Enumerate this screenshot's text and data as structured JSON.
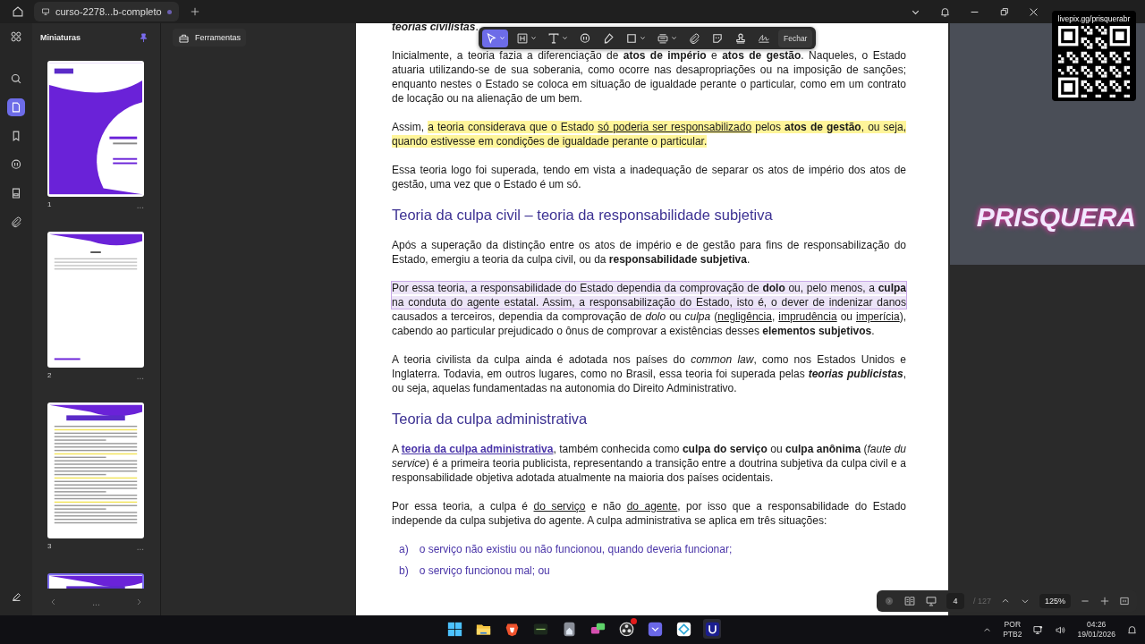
{
  "tab_bar": {
    "tab_title": "curso-2278...b-completo"
  },
  "rail": {
    "items": [
      {
        "selected": false
      },
      {
        "selected": true
      },
      {
        "selected": false
      },
      {
        "selected": false
      },
      {
        "selected": false
      },
      {
        "selected": false
      }
    ]
  },
  "thumbnails": {
    "title": "Miniaturas",
    "pages": [
      {
        "kind": "cover",
        "number": "1",
        "selected": false
      },
      {
        "kind": "index",
        "number": "2",
        "selected": false
      },
      {
        "kind": "text",
        "number": "3",
        "selected": false
      },
      {
        "kind": "text",
        "selected": true
      }
    ],
    "nav_more": "..."
  },
  "tools_button": "Ferramentas",
  "annotation_toolbar": {
    "tools": [
      {
        "selected": true
      },
      {
        "selected": false
      },
      {
        "selected": false
      },
      {
        "selected": false
      },
      {
        "selected": false
      },
      {
        "selected": false
      },
      {
        "selected": false
      },
      {
        "selected": false
      },
      {
        "selected": false
      },
      {
        "selected": false
      },
      {
        "selected": false
      }
    ],
    "close_label": "Fechar"
  },
  "document": {
    "blocks": [
      {
        "kind": "paragraph",
        "segments": [
          {
            "text": "teorias civilistas",
            "kind": "bold_italic"
          },
          {
            "text": ".",
            "kind": "plain"
          }
        ]
      },
      {
        "kind": "paragraph",
        "segments": [
          {
            "text": "Inicialmente, a teoria fazia a diferenciação de **atos de império** e **atos de gestão**. Naqueles, o Estado atuaria utilizando-se de sua soberania, como ocorre nas desapropriações ou na imposição de sanções; enquanto nestes o Estado se coloca em situação de igualdade perante o particular, como em um contrato de locação ou na alienação de um bem.",
            "kind": "plain"
          }
        ]
      },
      {
        "kind": "paragraph",
        "segments": [
          {
            "text": "Assim, ",
            "kind": "plain"
          },
          {
            "text": "a teoria considerava que o Estado ",
            "kind": "highlight"
          },
          {
            "text": "só poderia ser responsabilizado",
            "kind": "highlight_underline"
          },
          {
            "text": " pelos **atos de gestão**, ou seja, quando estivesse em condições de igualdade perante o particular.",
            "kind": "highlight"
          }
        ]
      },
      {
        "kind": "paragraph",
        "segments": [
          {
            "text": "Essa teoria logo foi superada, tendo em vista a inadequação de separar os atos de império dos atos de gestão, uma vez que o Estado é um só.",
            "kind": "plain"
          }
        ]
      },
      {
        "kind": "heading",
        "text": "Teoria da culpa civil – teoria da responsabilidade subjetiva"
      },
      {
        "kind": "paragraph",
        "segments": [
          {
            "text": "Após a superação da distinção entre os atos de império e de gestão para fins de responsabilização do Estado, emergiu a teoria da culpa civil, ou da **responsabilidade subjetiva**.",
            "kind": "plain"
          }
        ]
      },
      {
        "kind": "paragraph",
        "segments": [
          {
            "text": "Por essa teoria, a responsabilidade do Estado dependia da comprovação de **dolo** ou, pelo menos, a **culpa** na conduta do agente estatal. Assim, a responsabilização do Estado, isto é, o dever de indenizar danos",
            "kind": "selection"
          },
          {
            "text": " causados a terceiros, dependia da comprovação de *dolo* ou *culpa* (",
            "kind": "plain"
          },
          {
            "text": "negligência",
            "kind": "underline"
          },
          {
            "text": ", ",
            "kind": "plain"
          },
          {
            "text": "imprudência",
            "kind": "underline"
          },
          {
            "text": " ou ",
            "kind": "plain"
          },
          {
            "text": "imperícia",
            "kind": "underline"
          },
          {
            "text": "), cabendo ao particular prejudicado o ônus de comprovar a existências desses **elementos subjetivos**.",
            "kind": "plain"
          }
        ]
      },
      {
        "kind": "paragraph",
        "segments": [
          {
            "text": "A teoria civilista da culpa ainda é adotada nos países do *common law*, como nos Estados Unidos e Inglaterra. Todavia, em outros lugares, como no Brasil, essa teoria foi superada pelas ",
            "kind": "plain"
          },
          {
            "text": "teorias publicistas",
            "kind": "bold_italic"
          },
          {
            "text": ", ou seja, aquelas fundamentadas na autonomia do Direito Administrativo.",
            "kind": "plain"
          }
        ]
      },
      {
        "kind": "heading",
        "text": "Teoria da culpa administrativa"
      },
      {
        "kind": "paragraph",
        "segments": [
          {
            "text": "A ",
            "kind": "plain"
          },
          {
            "text": "teoria da culpa administrativa",
            "kind": "link"
          },
          {
            "text": ", também conhecida como **culpa do serviço** ou **culpa anônima** (*faute du service*) é a primeira teoria publicista, representando a transição entre a doutrina subjetiva da culpa civil e a responsabilidade objetiva adotada atualmente na maioria dos países ocidentais.",
            "kind": "plain"
          }
        ]
      },
      {
        "kind": "paragraph",
        "segments": [
          {
            "text": "Por essa teoria, a culpa é ",
            "kind": "plain"
          },
          {
            "text": "do serviço",
            "kind": "underline"
          },
          {
            "text": " e não ",
            "kind": "plain"
          },
          {
            "text": "do agente",
            "kind": "underline"
          },
          {
            "text": ", por isso que a responsabilidade do Estado independe da culpa subjetiva do agente. A culpa administrativa se aplica em três situações:",
            "kind": "plain"
          }
        ]
      },
      {
        "kind": "list_item",
        "marker": "a)",
        "text": "o serviço não existiu ou não funcionou, quando deveria funcionar;"
      },
      {
        "kind": "list_item",
        "marker": "b)",
        "text": "o serviço funcionou mal; ou"
      }
    ]
  },
  "page_bar": {
    "page": "4",
    "total": "/ 127",
    "zoom": "125%"
  },
  "stream_overlay": {
    "qr_caption": "livepix.gg/prisquerabr",
    "logo_text": "PRISQUERA"
  },
  "taskbar": {
    "apps": [
      {
        "active": false,
        "badge": false
      },
      {
        "active": false,
        "badge": false
      },
      {
        "active": false,
        "badge": false
      },
      {
        "active": false,
        "badge": false
      },
      {
        "active": false,
        "badge": false
      },
      {
        "active": false,
        "badge": false
      },
      {
        "active": false,
        "badge": true
      },
      {
        "active": false,
        "badge": false
      },
      {
        "active": false,
        "badge": false
      },
      {
        "active": true,
        "badge": false
      }
    ],
    "language": "POR",
    "layout": "PTB2",
    "time": "04:26",
    "date": "19/01/2026"
  }
}
